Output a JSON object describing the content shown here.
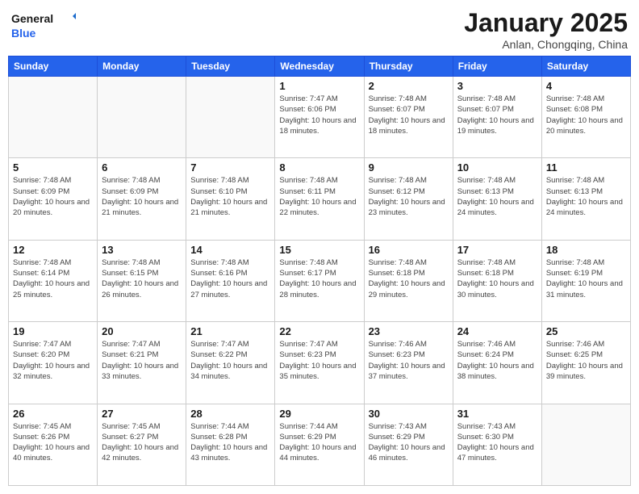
{
  "header": {
    "logo_general": "General",
    "logo_blue": "Blue",
    "month": "January 2025",
    "location": "Anlan, Chongqing, China"
  },
  "weekdays": [
    "Sunday",
    "Monday",
    "Tuesday",
    "Wednesday",
    "Thursday",
    "Friday",
    "Saturday"
  ],
  "weeks": [
    [
      {
        "day": "",
        "info": ""
      },
      {
        "day": "",
        "info": ""
      },
      {
        "day": "",
        "info": ""
      },
      {
        "day": "1",
        "info": "Sunrise: 7:47 AM\nSunset: 6:06 PM\nDaylight: 10 hours and 18 minutes."
      },
      {
        "day": "2",
        "info": "Sunrise: 7:48 AM\nSunset: 6:07 PM\nDaylight: 10 hours and 18 minutes."
      },
      {
        "day": "3",
        "info": "Sunrise: 7:48 AM\nSunset: 6:07 PM\nDaylight: 10 hours and 19 minutes."
      },
      {
        "day": "4",
        "info": "Sunrise: 7:48 AM\nSunset: 6:08 PM\nDaylight: 10 hours and 20 minutes."
      }
    ],
    [
      {
        "day": "5",
        "info": "Sunrise: 7:48 AM\nSunset: 6:09 PM\nDaylight: 10 hours and 20 minutes."
      },
      {
        "day": "6",
        "info": "Sunrise: 7:48 AM\nSunset: 6:09 PM\nDaylight: 10 hours and 21 minutes."
      },
      {
        "day": "7",
        "info": "Sunrise: 7:48 AM\nSunset: 6:10 PM\nDaylight: 10 hours and 21 minutes."
      },
      {
        "day": "8",
        "info": "Sunrise: 7:48 AM\nSunset: 6:11 PM\nDaylight: 10 hours and 22 minutes."
      },
      {
        "day": "9",
        "info": "Sunrise: 7:48 AM\nSunset: 6:12 PM\nDaylight: 10 hours and 23 minutes."
      },
      {
        "day": "10",
        "info": "Sunrise: 7:48 AM\nSunset: 6:13 PM\nDaylight: 10 hours and 24 minutes."
      },
      {
        "day": "11",
        "info": "Sunrise: 7:48 AM\nSunset: 6:13 PM\nDaylight: 10 hours and 24 minutes."
      }
    ],
    [
      {
        "day": "12",
        "info": "Sunrise: 7:48 AM\nSunset: 6:14 PM\nDaylight: 10 hours and 25 minutes."
      },
      {
        "day": "13",
        "info": "Sunrise: 7:48 AM\nSunset: 6:15 PM\nDaylight: 10 hours and 26 minutes."
      },
      {
        "day": "14",
        "info": "Sunrise: 7:48 AM\nSunset: 6:16 PM\nDaylight: 10 hours and 27 minutes."
      },
      {
        "day": "15",
        "info": "Sunrise: 7:48 AM\nSunset: 6:17 PM\nDaylight: 10 hours and 28 minutes."
      },
      {
        "day": "16",
        "info": "Sunrise: 7:48 AM\nSunset: 6:18 PM\nDaylight: 10 hours and 29 minutes."
      },
      {
        "day": "17",
        "info": "Sunrise: 7:48 AM\nSunset: 6:18 PM\nDaylight: 10 hours and 30 minutes."
      },
      {
        "day": "18",
        "info": "Sunrise: 7:48 AM\nSunset: 6:19 PM\nDaylight: 10 hours and 31 minutes."
      }
    ],
    [
      {
        "day": "19",
        "info": "Sunrise: 7:47 AM\nSunset: 6:20 PM\nDaylight: 10 hours and 32 minutes."
      },
      {
        "day": "20",
        "info": "Sunrise: 7:47 AM\nSunset: 6:21 PM\nDaylight: 10 hours and 33 minutes."
      },
      {
        "day": "21",
        "info": "Sunrise: 7:47 AM\nSunset: 6:22 PM\nDaylight: 10 hours and 34 minutes."
      },
      {
        "day": "22",
        "info": "Sunrise: 7:47 AM\nSunset: 6:23 PM\nDaylight: 10 hours and 35 minutes."
      },
      {
        "day": "23",
        "info": "Sunrise: 7:46 AM\nSunset: 6:23 PM\nDaylight: 10 hours and 37 minutes."
      },
      {
        "day": "24",
        "info": "Sunrise: 7:46 AM\nSunset: 6:24 PM\nDaylight: 10 hours and 38 minutes."
      },
      {
        "day": "25",
        "info": "Sunrise: 7:46 AM\nSunset: 6:25 PM\nDaylight: 10 hours and 39 minutes."
      }
    ],
    [
      {
        "day": "26",
        "info": "Sunrise: 7:45 AM\nSunset: 6:26 PM\nDaylight: 10 hours and 40 minutes."
      },
      {
        "day": "27",
        "info": "Sunrise: 7:45 AM\nSunset: 6:27 PM\nDaylight: 10 hours and 42 minutes."
      },
      {
        "day": "28",
        "info": "Sunrise: 7:44 AM\nSunset: 6:28 PM\nDaylight: 10 hours and 43 minutes."
      },
      {
        "day": "29",
        "info": "Sunrise: 7:44 AM\nSunset: 6:29 PM\nDaylight: 10 hours and 44 minutes."
      },
      {
        "day": "30",
        "info": "Sunrise: 7:43 AM\nSunset: 6:29 PM\nDaylight: 10 hours and 46 minutes."
      },
      {
        "day": "31",
        "info": "Sunrise: 7:43 AM\nSunset: 6:30 PM\nDaylight: 10 hours and 47 minutes."
      },
      {
        "day": "",
        "info": ""
      }
    ]
  ]
}
